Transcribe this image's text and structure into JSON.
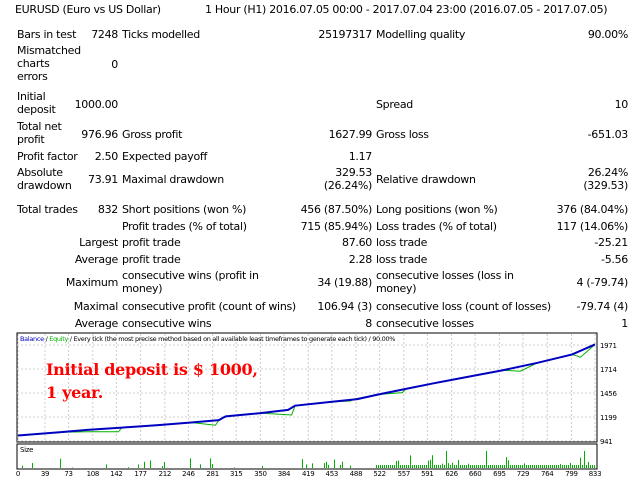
{
  "header": {
    "symbol": "EURUSD (Euro vs US Dollar)",
    "period": "1 Hour (H1) 2016.07.05 00:00 - 2017.07.04 23:00 (2016.07.05 - 2017.07.05)"
  },
  "stats": {
    "bars_label": "Bars in test",
    "bars": "7248",
    "ticks_label": "Ticks modelled",
    "ticks": "25197317",
    "quality_label": "Modelling quality",
    "quality": "90.00%",
    "mismatch_label": "Mismatched charts errors",
    "mismatch": "0",
    "deposit_label": "Initial deposit",
    "deposit": "1000.00",
    "spread_label": "Spread",
    "spread": "10",
    "net_label": "Total net profit",
    "net": "976.96",
    "gp_label": "Gross profit",
    "gp": "1627.99",
    "gl_label": "Gross loss",
    "gl": "-651.03",
    "pf_label": "Profit factor",
    "pf": "2.50",
    "ep_label": "Expected payoff",
    "ep": "1.17",
    "add_label": "Absolute drawdown",
    "add": "73.91",
    "mdd_label": "Maximal drawdown",
    "mdd": "329.53 (26.24%)",
    "rdd_label": "Relative drawdown",
    "rdd": "26.24% (329.53)",
    "tt_label": "Total trades",
    "tt": "832",
    "sp_label": "Short positions (won %)",
    "sp": "456 (87.50%)",
    "lp_label": "Long positions (won %)",
    "lp": "376 (84.04%)",
    "pt_label": "Profit trades (% of total)",
    "pt": "715 (85.94%)",
    "lt_label": "Loss trades (% of total)",
    "lt": "117 (14.06%)",
    "largest_label": "Largest",
    "lpt_label": "profit trade",
    "lpt": "87.60",
    "llt_label": "loss trade",
    "llt": "-25.21",
    "average_label": "Average",
    "apt_label": "profit trade",
    "apt": "2.28",
    "alt_label": "loss trade",
    "alt": "-5.56",
    "maximum_label": "Maximum",
    "mcw_label": "consecutive wins (profit in money)",
    "mcw": "34 (19.88)",
    "mcl_label": "consecutive losses (loss in money)",
    "mcl": "4 (-79.74)",
    "maximal_label": "Maximal",
    "mcp_label": "consecutive profit (count of wins)",
    "mcp": "106.94 (3)",
    "mclc_label": "consecutive loss (count of losses)",
    "mclc": "-79.74 (4)",
    "avg2_label": "Average",
    "acw_label": "consecutive wins",
    "acw": "8",
    "acl_label": "consecutive losses",
    "acl": "1"
  },
  "chart": {
    "legend_balance": "Balance",
    "legend_sep": " / ",
    "legend_equity": "Equity",
    "legend_rest": " / Every tick (the most precise method based on all available least timeframes to generate each tick) / 90.00%",
    "note1": "Initial deposit is $ 1000,",
    "note2": "1 year.",
    "size_label": "Size",
    "balance_color": "#0000c0",
    "equity_color": "#00b000"
  },
  "chart_data": {
    "type": "line",
    "xlabel": "",
    "ylabel": "",
    "yticks": [
      "1971",
      "1714",
      "1456",
      "1199",
      "941"
    ],
    "ylim": [
      941,
      1971
    ],
    "xticks": [
      "0",
      "39",
      "73",
      "108",
      "142",
      "177",
      "212",
      "246",
      "281",
      "315",
      "350",
      "384",
      "419",
      "453",
      "488",
      "522",
      "557",
      "591",
      "626",
      "660",
      "695",
      "729",
      "764",
      "799",
      "833"
    ],
    "xlim": [
      0,
      833
    ],
    "series": [
      {
        "name": "Balance",
        "x": [
          0,
          60,
          100,
          150,
          200,
          250,
          290,
          296,
          300,
          350,
          390,
          400,
          450,
          490,
          520,
          560,
          600,
          650,
          700,
          750,
          800,
          833
        ],
        "values": [
          1000,
          1035,
          1060,
          1085,
          1110,
          1140,
          1165,
          1190,
          1205,
          1240,
          1275,
          1320,
          1360,
          1390,
          1440,
          1500,
          1560,
          1630,
          1700,
          1780,
          1870,
          1977
        ]
      },
      {
        "name": "Equity",
        "x": [
          0,
          60,
          100,
          145,
          150,
          200,
          250,
          285,
          290,
          300,
          350,
          395,
          400,
          450,
          480,
          485,
          520,
          555,
          560,
          600,
          650,
          700,
          725,
          750,
          800,
          812,
          833
        ],
        "values": [
          1000,
          1035,
          1040,
          1040,
          1085,
          1110,
          1140,
          1110,
          1165,
          1205,
          1240,
          1220,
          1320,
          1360,
          1370,
          1390,
          1440,
          1460,
          1500,
          1560,
          1630,
          1700,
          1690,
          1780,
          1870,
          1840,
          1977
        ]
      }
    ]
  }
}
